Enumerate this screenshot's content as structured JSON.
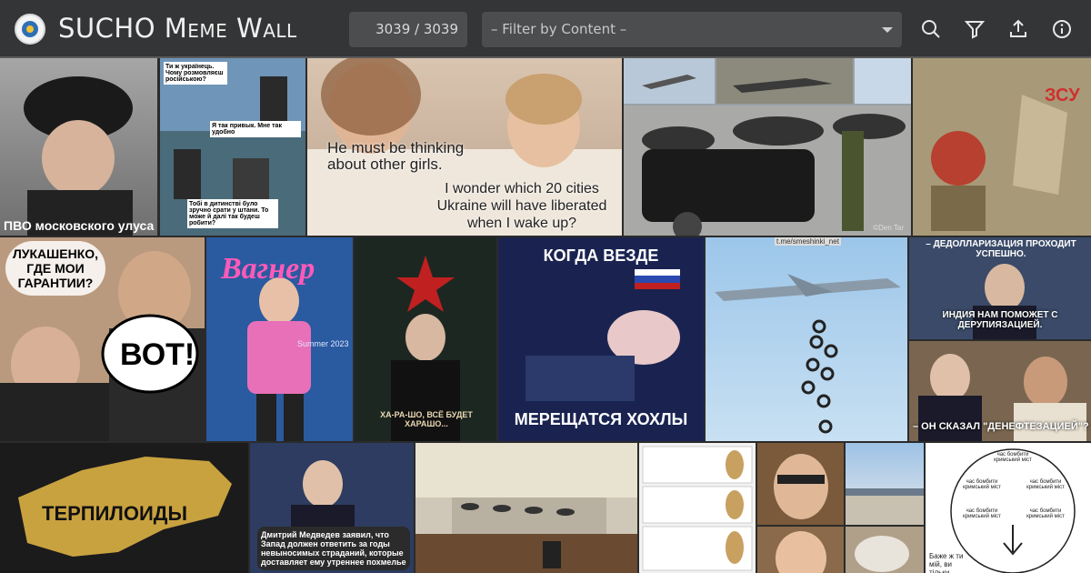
{
  "header": {
    "title_main": "SUCHO",
    "title_rest": "Meme Wall",
    "counter": "3039 / 3039",
    "filter_placeholder": "– Filter by Content –",
    "icons": [
      "search-icon",
      "filter-icon",
      "upload-icon",
      "info-icon"
    ]
  },
  "tiles": [
    {
      "caption": "ПВО московского улуса"
    },
    {
      "speech1": "Ти ж українець. Чому розмовляєш російською?",
      "speech2": "Я так привык. Мне так удобно",
      "speech3": "Тобі в дитинстві було зручно срати у штани. То може й далі так будеш робити?"
    },
    {
      "caption1": "He must be thinking about other girls.",
      "caption2": "I wonder which 20 cities Ukraine will have liberated when I wake up?"
    },
    {
      "credit": "©Den Tar"
    },
    {
      "label": "ЗСУ"
    },
    {
      "top": "ЛУКАШЕНКО, ГДЕ МОИ ГАРАНТИИ?",
      "bubble": "ВОТ!"
    },
    {
      "brand": "Вагнер",
      "sub": "Summer 2023"
    },
    {
      "caption": "ХА-РА-ШО, ВСЁ БУДЕТ ХАРАШО..."
    },
    {
      "top": "КОГДА ВЕЗДЕ",
      "bottom": "МЕРЕЩАТСЯ ХОХЛЫ"
    },
    {
      "credit": "t.me/smeshinki_net"
    },
    {
      "top": "– ДЕДОЛЛАРИЗАЦИЯ ПРОХОДИТ УСПЕШНО.",
      "bottom": "ИНДИЯ НАМ ПОМОЖЕТ С ДЕРУПИЯЗАЦИЕЙ."
    },
    {
      "bottom": "– ОН СКАЗАЛ \"ДЕНЕФТЕЗАЦИЕЙ\"?"
    },
    {
      "caption": "ТЕРПИЛОИДЫ"
    },
    {
      "caption": "Дмитрий Медведев заявил, что Запад должен ответить за годы невыносимых страданий, которые доставляет ему утреннее похмелье"
    },
    {},
    {},
    {},
    {},
    {},
    {},
    {
      "ring": "час бомбити кримський міст",
      "bottom": "Баже ж ти мій, ви тільки подивіться"
    }
  ],
  "colors": {
    "header_bg": "#333536",
    "input_bg": "#4b4d4f",
    "text": "#f0f0f0"
  }
}
